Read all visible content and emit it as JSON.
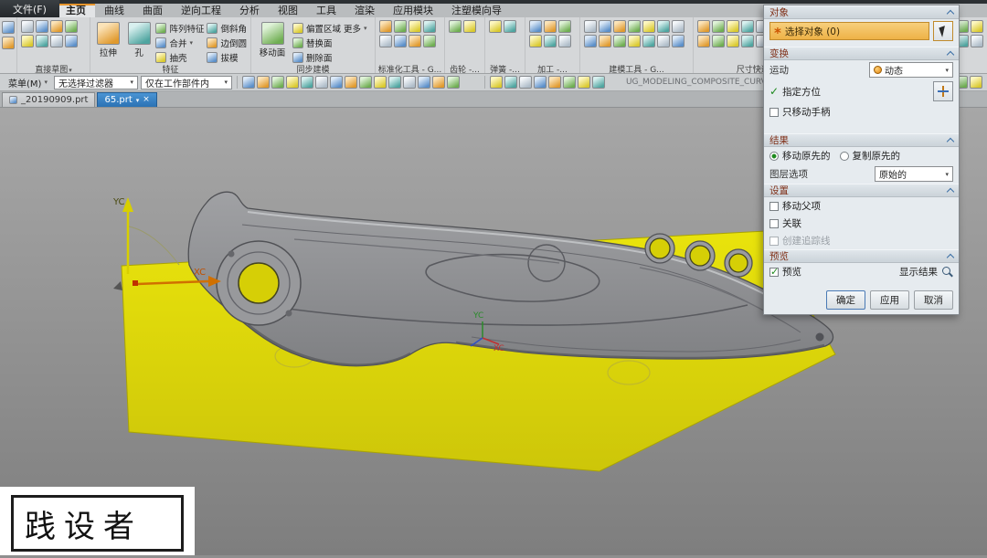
{
  "window": {
    "file_menu": "文件(F)"
  },
  "ribbon_tabs": [
    {
      "label": "主页",
      "active": true
    },
    {
      "label": "曲线"
    },
    {
      "label": "曲面"
    },
    {
      "label": "逆向工程"
    },
    {
      "label": "分析"
    },
    {
      "label": "视图"
    },
    {
      "label": "工具"
    },
    {
      "label": "渲染"
    },
    {
      "label": "应用模块"
    },
    {
      "label": "注塑模向导"
    }
  ],
  "ribbon": {
    "direct_sketch_label": "直接草图",
    "feature": {
      "label": "特征",
      "extrude": "拉伸",
      "hole": "孔",
      "pattern": "阵列特征",
      "unite": "合并",
      "shell": "抽壳",
      "chamfer": "倒斜角",
      "edge_blend": "边倒圆",
      "draft": "拔模",
      "more": "更多"
    },
    "sync": {
      "label": "同步建模",
      "move_face": "移动面",
      "offset_region": "偏置区域",
      "replace_face": "替换面",
      "delete_face": "删除面",
      "more": "更多"
    },
    "group_labels": {
      "std_tools": "标准化工具 - G...",
      "gear": "齿轮 -...",
      "spring": "弹簧 -...",
      "machining": "加工 -...",
      "modeling_tools": "建模工具 - G...",
      "dim_tools": "尺寸快速格式化工具 - G..."
    }
  },
  "toolbar": {
    "menu": "菜单(M)",
    "filter": "无选择过滤器",
    "scope": "仅在工作部件内",
    "hint": "UG_MODELING_COMPOSITE_CURVE_FEATURE..."
  },
  "part_tabs": [
    {
      "label": "_20190909.prt"
    },
    {
      "label": "65.prt",
      "active": true
    }
  ],
  "dialog": {
    "object_title": "对象",
    "select_object": "选择对象 (0)",
    "transform_title": "变换",
    "motion_label": "运动",
    "motion_value": "动态",
    "specify_orientation": "指定方位",
    "move_handles_only": "只移动手柄",
    "result_title": "结果",
    "move_original": "移动原先的",
    "copy_original": "复制原先的",
    "layer_option_label": "图层选项",
    "layer_option_value": "原始的",
    "settings_title": "设置",
    "move_parent": "移动父项",
    "associative": "关联",
    "create_traceline": "创建追踪线",
    "preview_title": "预览",
    "preview": "预览",
    "show_result": "显示结果",
    "ok": "确定",
    "apply": "应用",
    "cancel": "取消"
  },
  "viewport": {
    "wcs_y": "YC",
    "wcs_x": "XC",
    "csys_y": "YC",
    "csys_x": "XC"
  },
  "watermark": "践设者",
  "colors": {
    "sheet_yellow": "#ddd607",
    "selection_highlight": "#f2b449",
    "active_tab_blue": "#2f7dc4",
    "section_title_maroon": "#803018"
  }
}
